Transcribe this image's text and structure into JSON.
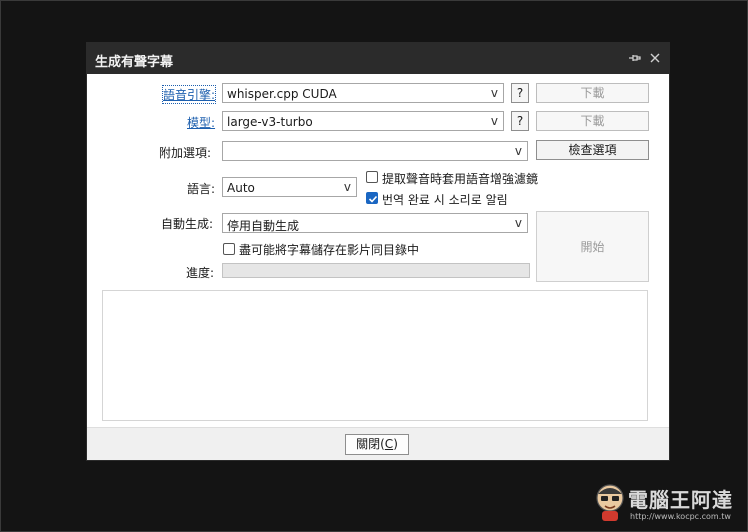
{
  "window": {
    "title": "生成有聲字幕"
  },
  "form": {
    "engine": {
      "label": "語音引擎:",
      "value": "whisper.cpp CUDA",
      "help": "?",
      "download": "下載"
    },
    "model": {
      "label": "模型:",
      "value": "large-v3-turbo",
      "help": "?",
      "download": "下載"
    },
    "extra": {
      "label": "附加選項:",
      "value": "",
      "check_button": "檢查選項"
    },
    "language": {
      "label": "語言:",
      "value": "Auto"
    },
    "filter_checkbox": {
      "label": "提取聲音時套用語音增強濾鏡",
      "checked": false
    },
    "notify_checkbox": {
      "label": "번역 완료 시 소리로 알림",
      "checked": true
    },
    "auto": {
      "label": "自動生成:",
      "value": "停用自動生成"
    },
    "save_checkbox": {
      "label": "盡可能將字幕儲存在影片同目錄中",
      "checked": false
    },
    "progress": {
      "label": "進度:",
      "value": 0
    },
    "start_button": "開始"
  },
  "footer": {
    "close_label": "關閉(",
    "close_key": "C",
    "close_end": ")"
  },
  "watermark": {
    "text": "電腦王阿達",
    "url": "http://www.kocpc.com.tw"
  },
  "colors": {
    "titlebar": "#2b2b2b",
    "link": "#1d5fae",
    "checkbox_on": "#1a66c2"
  }
}
